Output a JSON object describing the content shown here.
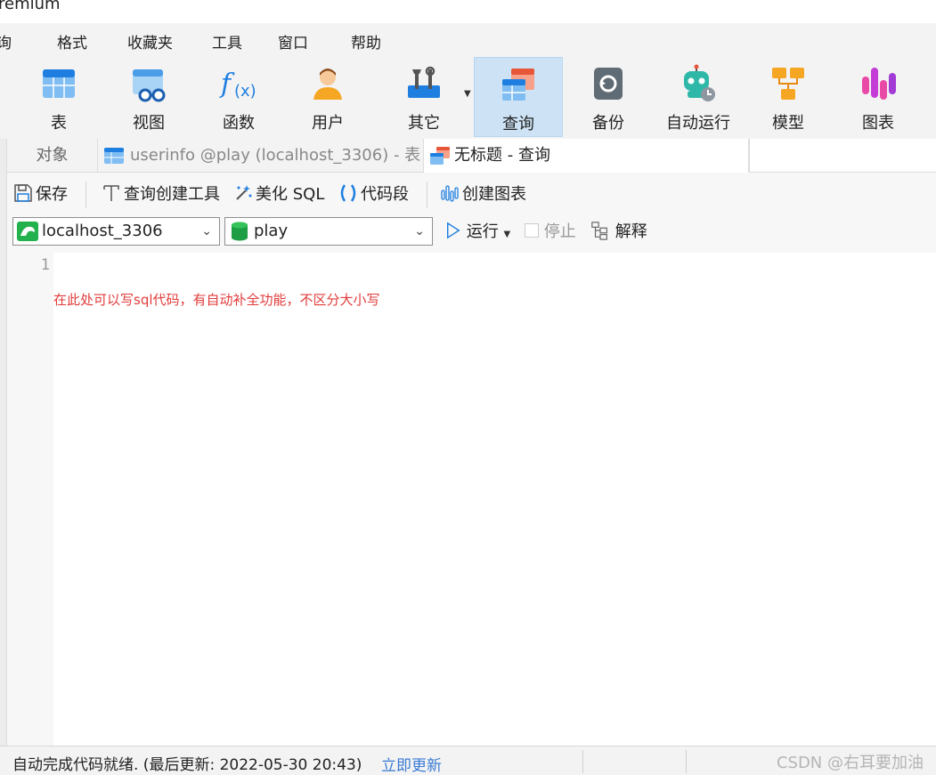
{
  "window": {
    "title": "remium"
  },
  "menu": [
    "询",
    "格式",
    "收藏夹",
    "工具",
    "窗口",
    "帮助"
  ],
  "toolbar": {
    "items": [
      {
        "label": "表",
        "icon": "table-icon"
      },
      {
        "label": "视图",
        "icon": "view-icon"
      },
      {
        "label": "函数",
        "icon": "function-icon"
      },
      {
        "label": "用户",
        "icon": "user-icon"
      },
      {
        "label": "其它",
        "icon": "tools-icon"
      },
      {
        "label": "查询",
        "icon": "query-icon"
      },
      {
        "label": "备份",
        "icon": "backup-icon"
      },
      {
        "label": "自动运行",
        "icon": "robot-icon"
      },
      {
        "label": "模型",
        "icon": "model-icon"
      },
      {
        "label": "图表",
        "icon": "chart-icon"
      }
    ]
  },
  "tabs": {
    "objects": "对象",
    "table_tab": "userinfo @play (localhost_3306) - 表",
    "query_tab": "无标题 - 查询"
  },
  "query_toolbar": {
    "save": "保存",
    "builder": "查询创建工具",
    "beautify": "美化 SQL",
    "snippet": "代码段",
    "create_chart": "创建图表"
  },
  "selectors": {
    "connection": "localhost_3306",
    "database": "play",
    "run": "运行",
    "stop": "停止",
    "explain": "解释"
  },
  "editor": {
    "line_number": "1",
    "hint": "在此处可以写sql代码，有自动补全功能，不区分大小写"
  },
  "status": {
    "message": "自动完成代码就绪. (最后更新: 2022-05-30 20:43)",
    "update_link": "立即更新",
    "watermark": "CSDN @右耳要加油"
  }
}
